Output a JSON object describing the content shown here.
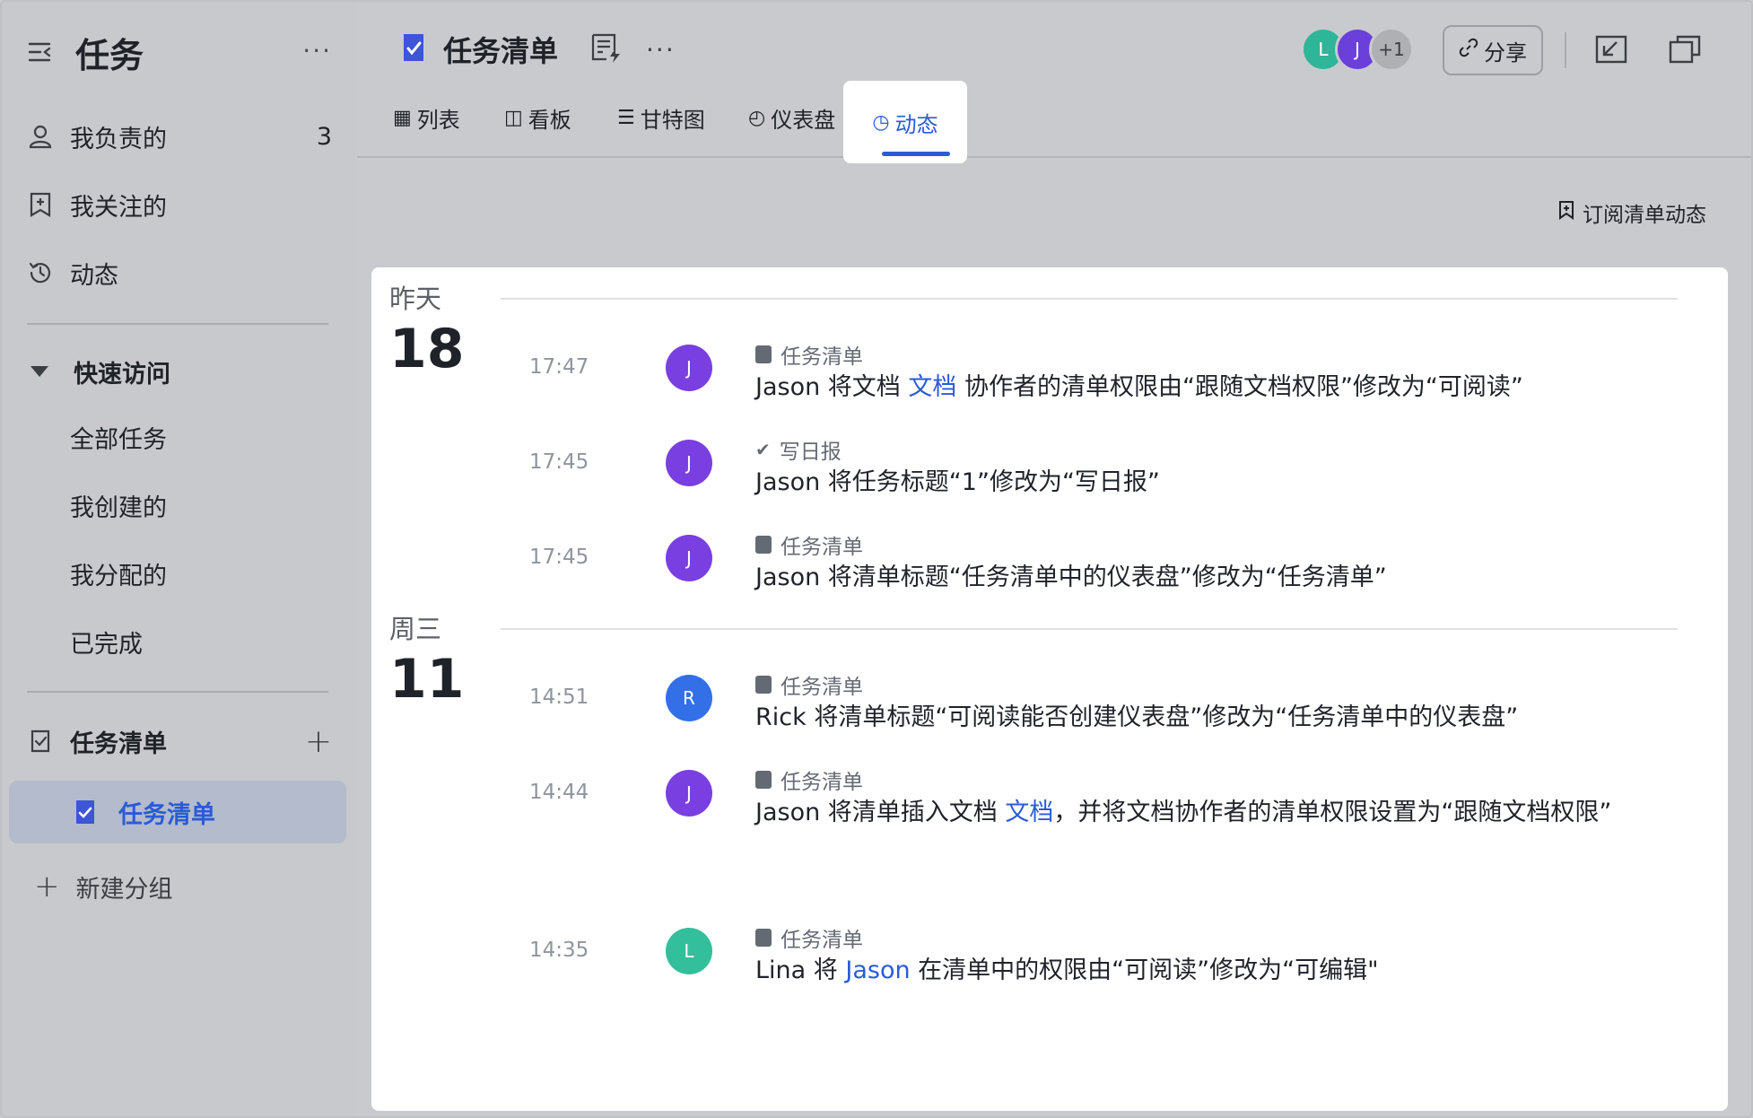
{
  "sidebar": {
    "title": "任务",
    "items": [
      {
        "label": "我负责的",
        "count": "3"
      },
      {
        "label": "我关注的"
      },
      {
        "label": "动态"
      }
    ],
    "quick_access": {
      "title": "快速访问",
      "items": [
        "全部任务",
        "我创建的",
        "我分配的",
        "已完成"
      ]
    },
    "lists_section": {
      "title": "任务清单"
    },
    "active_list": "任务清单",
    "new_group": "新建分组"
  },
  "header": {
    "title": "任务清单",
    "avatars": [
      {
        "initial": "L",
        "color": "#2fb598"
      },
      {
        "initial": "J",
        "color": "#6b3fd9"
      },
      {
        "initial": "+1",
        "color": "#aeb0b4"
      }
    ],
    "share_label": "分享"
  },
  "tabs": [
    {
      "label": "列表"
    },
    {
      "label": "看板"
    },
    {
      "label": "甘特图"
    },
    {
      "label": "仪表盘"
    },
    {
      "label": "动态",
      "active": true
    }
  ],
  "subscribe_label": "订阅清单动态",
  "colors": {
    "accent": "#2a5bd7"
  },
  "feed": [
    {
      "day_label": "昨天",
      "day_num": "18",
      "entries": [
        {
          "time": "17:47",
          "avatar": "J",
          "avatar_color": "#7a3fe0",
          "source": "任务清单",
          "source_icon": "list-icon",
          "msg_pre": "Jason 将文档 ",
          "msg_link": "文档",
          "msg_post": " 协作者的清单权限由“跟随文档权限”修改为“可阅读”"
        },
        {
          "time": "17:45",
          "avatar": "J",
          "avatar_color": "#7a3fe0",
          "source": "写日报",
          "source_icon": "check-icon",
          "msg_pre": "Jason 将任务标题“1”修改为“写日报”",
          "msg_link": "",
          "msg_post": ""
        },
        {
          "time": "17:45",
          "avatar": "J",
          "avatar_color": "#7a3fe0",
          "source": "任务清单",
          "source_icon": "list-icon",
          "msg_pre": "Jason 将清单标题“任务清单中的仪表盘”修改为“任务清单”",
          "msg_link": "",
          "msg_post": ""
        }
      ]
    },
    {
      "day_label": "周三",
      "day_num": "11",
      "entries": [
        {
          "time": "14:51",
          "avatar": "R",
          "avatar_color": "#3370e8",
          "source": "任务清单",
          "source_icon": "list-icon",
          "msg_pre": "Rick 将清单标题“可阅读能否创建仪表盘”修改为“任务清单中的仪表盘”",
          "msg_link": "",
          "msg_post": ""
        },
        {
          "time": "14:44",
          "avatar": "J",
          "avatar_color": "#7a3fe0",
          "source": "任务清单",
          "source_icon": "list-icon",
          "msg_pre": "Jason 将清单插入文档 ",
          "msg_link": "文档",
          "msg_post": "，并将文档协作者的清单权限设置为“跟随文档权限”"
        },
        {
          "time": "14:35",
          "avatar": "L",
          "avatar_color": "#34bf9c",
          "source": "任务清单",
          "source_icon": "list-icon",
          "msg_pre": "Lina 将 ",
          "msg_link": "Jason",
          "msg_post": " 在清单中的权限由“可阅读”修改为“可编辑\""
        }
      ]
    }
  ]
}
